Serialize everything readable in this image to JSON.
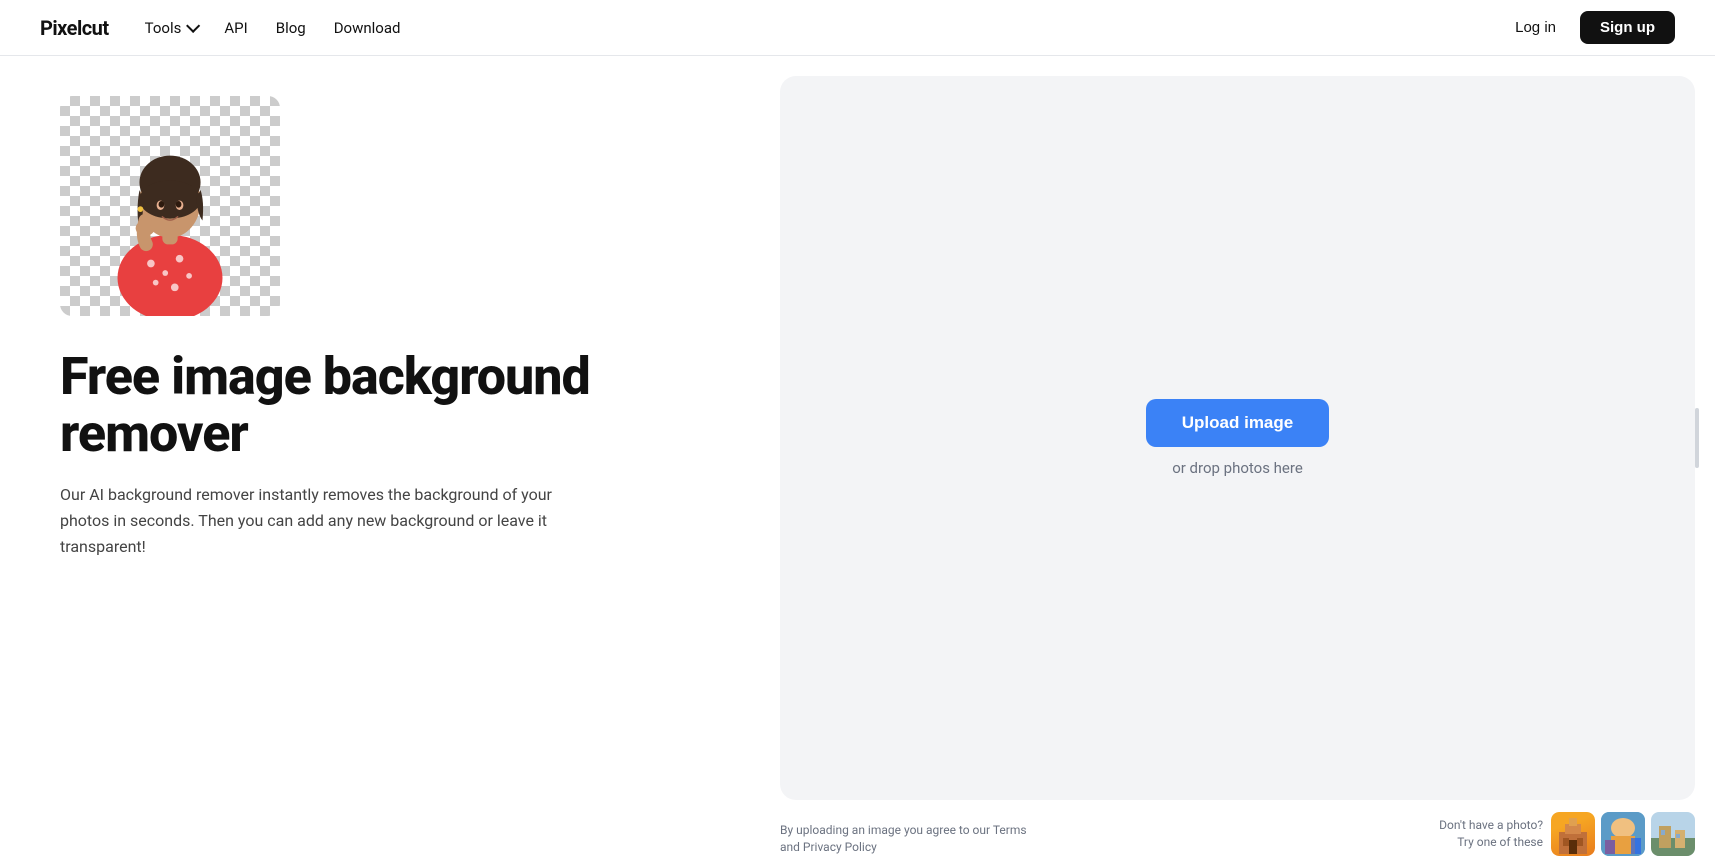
{
  "nav": {
    "logo": "Pixelcut",
    "links": [
      {
        "label": "Tools",
        "hasArrow": true
      },
      {
        "label": "API",
        "hasArrow": false
      },
      {
        "label": "Blog",
        "hasArrow": false
      },
      {
        "label": "Download",
        "hasArrow": false
      }
    ],
    "login_label": "Log in",
    "signup_label": "Sign up"
  },
  "hero": {
    "title": "Free image background remover",
    "description": "Our AI background remover instantly removes the background of your photos in seconds. Then you can add any new background or leave it transparent!"
  },
  "upload": {
    "button_label": "Upload image",
    "drop_text": "or drop photos here"
  },
  "bottom": {
    "terms_text": "By uploading an image you agree to our Terms and Privacy Policy",
    "sample_label": "Don't have a photo?",
    "sample_sublabel": "Try one of these"
  }
}
